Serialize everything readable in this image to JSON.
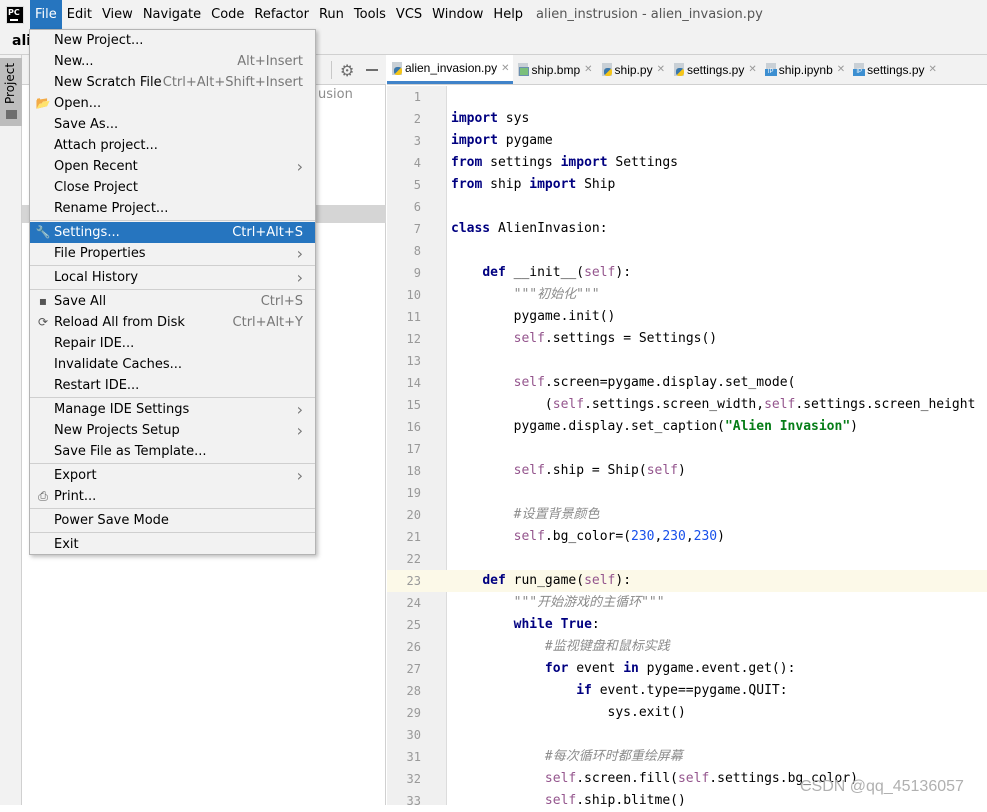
{
  "window": {
    "title": "alien_instrusion - alien_invasion.py",
    "logo": "PC"
  },
  "menubar": [
    "File",
    "Edit",
    "View",
    "Navigate",
    "Code",
    "Refactor",
    "Run",
    "Tools",
    "VCS",
    "Window",
    "Help"
  ],
  "toolbar": {
    "breadcrumb": "ali"
  },
  "stripe": {
    "project_label": "Project"
  },
  "project_panel": {
    "partial_text": "usion"
  },
  "file_menu": [
    {
      "label": "New Project...",
      "shortcut": ""
    },
    {
      "label": "New...",
      "shortcut": "Alt+Insert"
    },
    {
      "label": "New Scratch File",
      "shortcut": "Ctrl+Alt+Shift+Insert"
    },
    {
      "label": "Open...",
      "shortcut": "",
      "icon": "folder-icon"
    },
    {
      "label": "Save As...",
      "shortcut": ""
    },
    {
      "label": "Attach project...",
      "shortcut": ""
    },
    {
      "label": "Open Recent",
      "shortcut": "",
      "submenu": true
    },
    {
      "label": "Close Project",
      "shortcut": ""
    },
    {
      "label": "Rename Project...",
      "shortcut": "",
      "sep": true
    },
    {
      "label": "Settings...",
      "shortcut": "Ctrl+Alt+S",
      "icon": "wrench-icon",
      "selected": true
    },
    {
      "label": "File Properties",
      "shortcut": "",
      "submenu": true,
      "sep": true
    },
    {
      "label": "Local History",
      "shortcut": "",
      "submenu": true,
      "sep": true
    },
    {
      "label": "Save All",
      "shortcut": "Ctrl+S",
      "icon": "save-icon"
    },
    {
      "label": "Reload All from Disk",
      "shortcut": "Ctrl+Alt+Y",
      "icon": "reload-icon"
    },
    {
      "label": "Repair IDE...",
      "shortcut": ""
    },
    {
      "label": "Invalidate Caches...",
      "shortcut": ""
    },
    {
      "label": "Restart IDE...",
      "shortcut": "",
      "sep": true
    },
    {
      "label": "Manage IDE Settings",
      "shortcut": "",
      "submenu": true
    },
    {
      "label": "New Projects Setup",
      "shortcut": "",
      "submenu": true
    },
    {
      "label": "Save File as Template...",
      "shortcut": "",
      "sep": true
    },
    {
      "label": "Export",
      "shortcut": "",
      "submenu": true
    },
    {
      "label": "Print...",
      "shortcut": "",
      "icon": "print-icon",
      "sep": true
    },
    {
      "label": "Power Save Mode",
      "shortcut": "",
      "sep": true
    },
    {
      "label": "Exit",
      "shortcut": ""
    }
  ],
  "tabs": [
    {
      "label": "alien_invasion.py",
      "type": "py",
      "active": true
    },
    {
      "label": "ship.bmp",
      "type": "bmp"
    },
    {
      "label": "ship.py",
      "type": "py"
    },
    {
      "label": "settings.py",
      "type": "py"
    },
    {
      "label": "ship.ipynb",
      "type": "ip"
    },
    {
      "label": "settings.py",
      "type": "ip"
    }
  ],
  "editor": {
    "current_line": 23,
    "lines": [
      [],
      [
        [
          "k",
          "import"
        ],
        [
          "p",
          " sys"
        ]
      ],
      [
        [
          "k",
          "import"
        ],
        [
          "p",
          " pygame"
        ]
      ],
      [
        [
          "k",
          "from"
        ],
        [
          "p",
          " settings "
        ],
        [
          "k",
          "import"
        ],
        [
          "p",
          " Settings"
        ]
      ],
      [
        [
          "k",
          "from"
        ],
        [
          "p",
          " ship "
        ],
        [
          "k",
          "import"
        ],
        [
          "p",
          " Ship"
        ]
      ],
      [],
      [
        [
          "k",
          "class"
        ],
        [
          "p",
          " AlienInvasion:"
        ]
      ],
      [],
      [
        [
          "p",
          "    "
        ],
        [
          "k",
          "def"
        ],
        [
          "p",
          " __init__("
        ],
        [
          "s",
          "self"
        ],
        [
          "p",
          "):"
        ]
      ],
      [
        [
          "p",
          "        "
        ],
        [
          "c",
          "\"\"\"初始化\"\"\""
        ]
      ],
      [
        [
          "p",
          "        pygame.init()"
        ]
      ],
      [
        [
          "p",
          "        "
        ],
        [
          "s",
          "self"
        ],
        [
          "p",
          ".settings = Settings()"
        ]
      ],
      [],
      [
        [
          "p",
          "        "
        ],
        [
          "s",
          "self"
        ],
        [
          "p",
          ".screen=pygame.display.set_mode("
        ]
      ],
      [
        [
          "p",
          "            ("
        ],
        [
          "s",
          "self"
        ],
        [
          "p",
          ".settings.screen_width,"
        ],
        [
          "s",
          "self"
        ],
        [
          "p",
          ".settings.screen_height"
        ]
      ],
      [
        [
          "p",
          "        pygame.display.set_caption("
        ],
        [
          "str",
          "\"Alien Invasion\""
        ],
        [
          "p",
          ")"
        ]
      ],
      [],
      [
        [
          "p",
          "        "
        ],
        [
          "s",
          "self"
        ],
        [
          "p",
          ".ship = Ship("
        ],
        [
          "s",
          "self"
        ],
        [
          "p",
          ")"
        ]
      ],
      [],
      [
        [
          "p",
          "        "
        ],
        [
          "c",
          "#设置背景颜色"
        ]
      ],
      [
        [
          "p",
          "        "
        ],
        [
          "s",
          "self"
        ],
        [
          "p",
          ".bg_color=("
        ],
        [
          "n",
          "230"
        ],
        [
          "p",
          ","
        ],
        [
          "n",
          "230"
        ],
        [
          "p",
          ","
        ],
        [
          "n",
          "230"
        ],
        [
          "p",
          ")"
        ]
      ],
      [],
      [
        [
          "p",
          "    "
        ],
        [
          "k",
          "def"
        ],
        [
          "p",
          " run_game("
        ],
        [
          "s",
          "self"
        ],
        [
          "p",
          "):"
        ]
      ],
      [
        [
          "p",
          "        "
        ],
        [
          "c",
          "\"\"\"开始游戏的主循环\"\"\""
        ]
      ],
      [
        [
          "p",
          "        "
        ],
        [
          "k",
          "while"
        ],
        [
          "p",
          " "
        ],
        [
          "k",
          "True"
        ],
        [
          "p",
          ":"
        ]
      ],
      [
        [
          "p",
          "            "
        ],
        [
          "c",
          "#监视键盘和鼠标实践"
        ]
      ],
      [
        [
          "p",
          "            "
        ],
        [
          "k",
          "for"
        ],
        [
          "p",
          " event "
        ],
        [
          "k",
          "in"
        ],
        [
          "p",
          " pygame.event.get():"
        ]
      ],
      [
        [
          "p",
          "                "
        ],
        [
          "k",
          "if"
        ],
        [
          "p",
          " event.type==pygame.QUIT:"
        ]
      ],
      [
        [
          "p",
          "                    sys.exit()"
        ]
      ],
      [],
      [
        [
          "p",
          "            "
        ],
        [
          "c",
          "#每次循环时都重绘屏幕"
        ]
      ],
      [
        [
          "p",
          "            "
        ],
        [
          "s",
          "self"
        ],
        [
          "p",
          ".screen.fill("
        ],
        [
          "s",
          "self"
        ],
        [
          "p",
          ".settings.bg_color)"
        ]
      ],
      [
        [
          "p",
          "            "
        ],
        [
          "s",
          "self"
        ],
        [
          "p",
          ".ship.blitme()"
        ]
      ]
    ]
  },
  "watermark": "CSDN @qq_45136057",
  "colors": {
    "accent": "#2675bf",
    "keyword": "#000080",
    "self": "#94558d",
    "string": "#067d17",
    "number": "#1750eb",
    "comment": "#8c8c8c"
  }
}
